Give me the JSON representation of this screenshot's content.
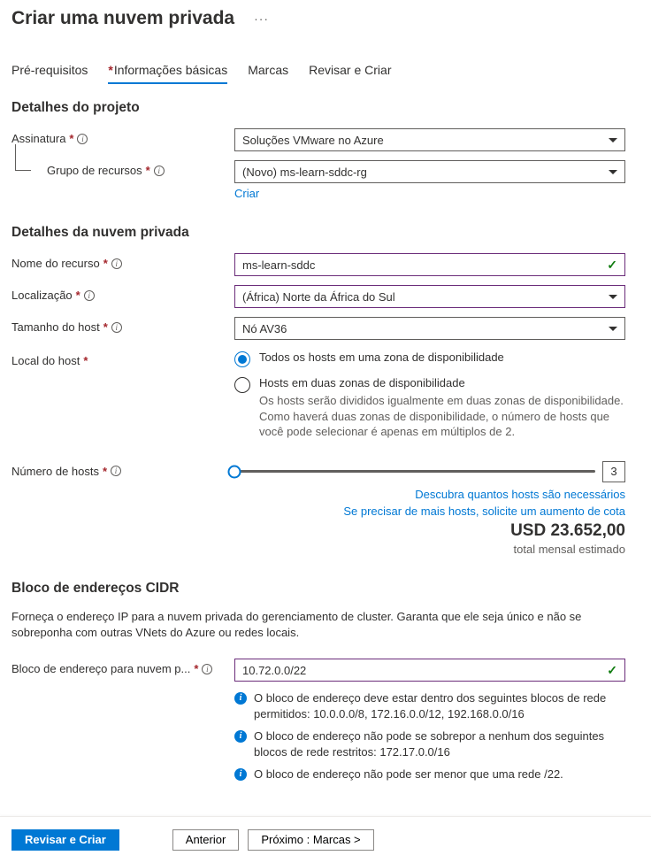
{
  "title": "Criar uma nuvem privada",
  "tabs": {
    "prereq": "Pré-requisitos",
    "basics": "Informações básicas",
    "tags": "Marcas",
    "review": "Revisar e Criar"
  },
  "project": {
    "heading": "Detalhes do projeto",
    "subscription_label": "Assinatura",
    "subscription_value": "Soluções VMware no Azure",
    "rg_label": "Grupo de recursos",
    "rg_value": "(Novo) ms-learn-sddc-rg",
    "rg_create": "Criar"
  },
  "cloud": {
    "heading": "Detalhes da nuvem privada",
    "name_label": "Nome do recurso",
    "name_value": "ms-learn-sddc",
    "location_label": "Localização",
    "location_value": "(África) Norte da África do Sul",
    "host_size_label": "Tamanho do host",
    "host_size_value": "Nó AV36",
    "host_loc_label": "Local do host",
    "radio1": "Todos os hosts em uma zona de disponibilidade",
    "radio2": "Hosts em duas zonas de disponibilidade",
    "radio2_desc": "Os hosts serão divididos igualmente em duas zonas de disponibilidade. Como haverá duas zonas de disponibilidade, o número de hosts que você pode selecionar é apenas em múltiplos de 2.",
    "hosts_label": "Número de hosts",
    "hosts_value": "3",
    "link1": "Descubra quantos hosts são necessários",
    "link2": "Se precisar de mais hosts, solicite um aumento de cota",
    "price": "USD 23.652,00",
    "price_sub": "total mensal estimado"
  },
  "cidr": {
    "heading": "Bloco de endereços CIDR",
    "desc": "Forneça o endereço IP para a nuvem privada do gerenciamento de cluster. Garanta que ele seja único e não se sobreponha com outras VNets do Azure ou redes locais.",
    "addr_label": "Bloco de endereço para nuvem p...",
    "addr_value": "10.72.0.0/22",
    "info1": "O bloco de endereço deve estar dentro dos seguintes blocos de rede permitidos: 10.0.0.0/8, 172.16.0.0/12, 192.168.0.0/16",
    "info2": "O bloco de endereço não pode se sobrepor a nenhum dos seguintes blocos de rede restritos: 172.17.0.0/16",
    "info3": "O bloco de endereço não pode ser menor que uma rede /22."
  },
  "footer": {
    "review": "Revisar e Criar",
    "prev": "Anterior",
    "next": "Próximo : Marcas >"
  }
}
